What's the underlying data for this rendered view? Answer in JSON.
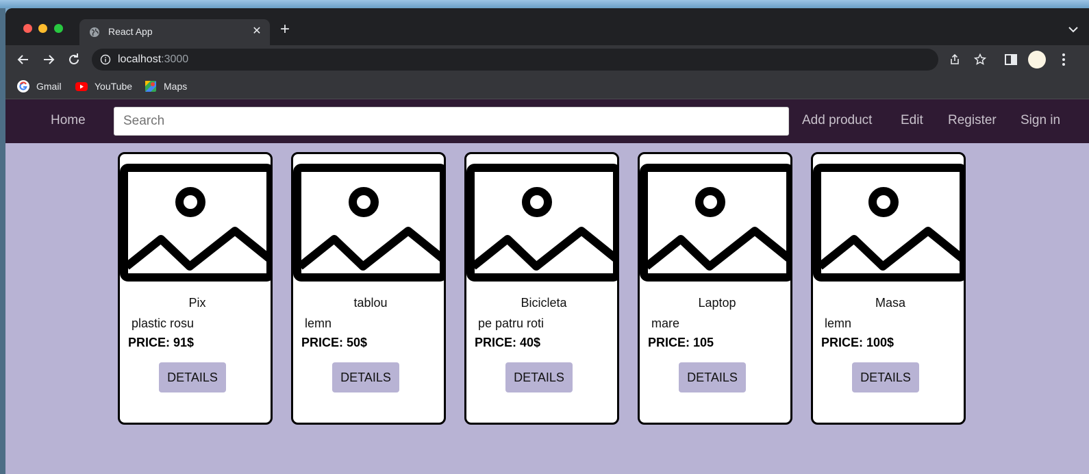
{
  "browser": {
    "tab_title": "React App",
    "tab_close": "✕",
    "new_tab": "+",
    "url_host": "localhost",
    "url_port": ":3000",
    "bookmarks": [
      "Gmail",
      "YouTube",
      "Maps"
    ]
  },
  "navbar": {
    "home": "Home",
    "search_placeholder": "Search",
    "add_product": "Add product",
    "edit": "Edit",
    "register": "Register",
    "sign_in": "Sign in"
  },
  "products": [
    {
      "name": "Pix",
      "description": "plastic rosu",
      "price": "PRICE: 91$",
      "button": "DETAILS"
    },
    {
      "name": "tablou",
      "description": "lemn",
      "price": "PRICE: 50$",
      "button": "DETAILS"
    },
    {
      "name": "Bicicleta",
      "description": "pe patru roti",
      "price": "PRICE: 40$",
      "button": "DETAILS"
    },
    {
      "name": "Laptop",
      "description": "mare",
      "price": "PRICE: 105",
      "button": "DETAILS"
    },
    {
      "name": "Masa",
      "description": "lemn",
      "price": "PRICE: 100$",
      "button": "DETAILS"
    }
  ],
  "colors": {
    "navbar_bg": "#2f1a33",
    "page_bg": "#b8b3d4",
    "button_bg": "#b8b3d4",
    "card_border": "#000000"
  },
  "icons": {
    "placeholder": "image-placeholder-icon",
    "back": "arrow-left-icon",
    "forward": "arrow-right-icon",
    "reload": "reload-icon"
  }
}
